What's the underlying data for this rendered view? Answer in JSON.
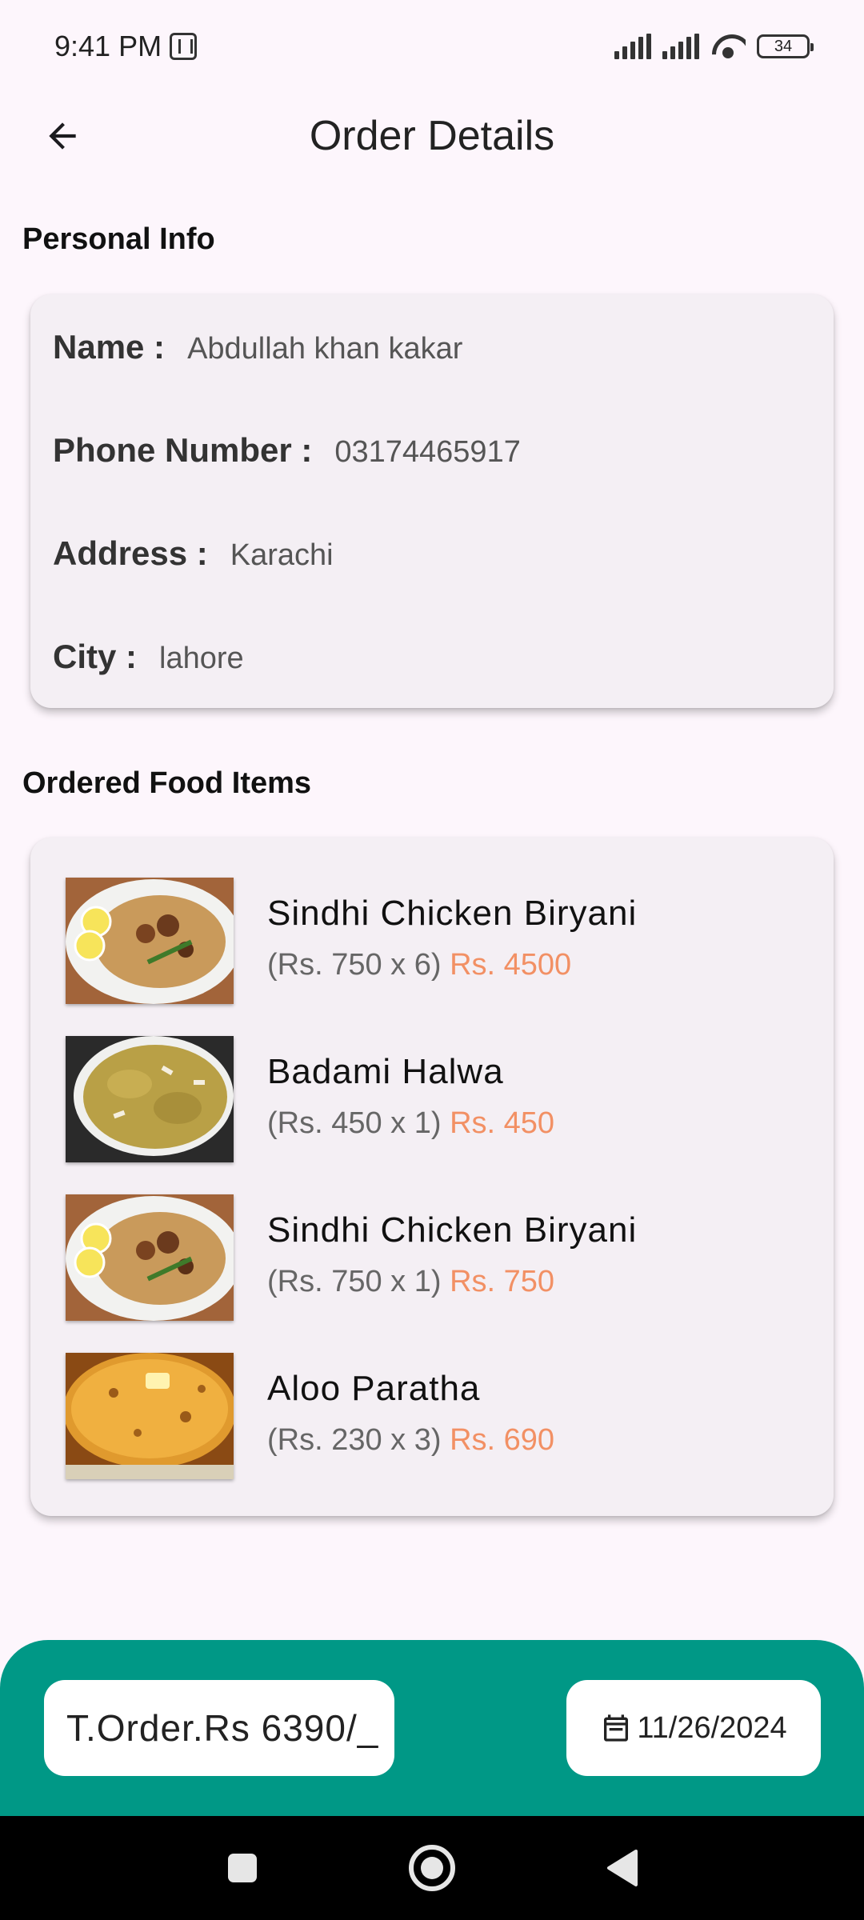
{
  "status_bar": {
    "time": "9:41 PM",
    "battery": "34"
  },
  "app_bar": {
    "title": "Order Details"
  },
  "personal_info": {
    "section_title": "Personal Info",
    "rows": [
      {
        "label": "Name :",
        "value": "Abdullah khan kakar"
      },
      {
        "label": "Phone Number :",
        "value": "03174465917"
      },
      {
        "label": "Address :",
        "value": "Karachi"
      },
      {
        "label": "City :",
        "value": "lahore"
      }
    ]
  },
  "ordered_items": {
    "section_title": "Ordered Food Items",
    "items": [
      {
        "name": "Sindhi Chicken Biryani",
        "unit": "(Rs. 750 x 6)",
        "total": "Rs. 4500",
        "image": "biryani"
      },
      {
        "name": "Badami Halwa",
        "unit": "(Rs. 450 x 1)",
        "total": "Rs. 450",
        "image": "halwa"
      },
      {
        "name": "Sindhi Chicken Biryani",
        "unit": "(Rs. 750 x 1)",
        "total": "Rs. 750",
        "image": "biryani"
      },
      {
        "name": "Aloo Paratha",
        "unit": "(Rs. 230 x 3)",
        "total": "Rs. 690",
        "image": "paratha"
      }
    ]
  },
  "bottom_bar": {
    "total_label": "T.Order.Rs 6390/_",
    "date": "11/26/2024"
  },
  "colors": {
    "accent": "#009886",
    "price_highlight": "#f29064",
    "card_bg": "#f4eff4",
    "page_bg": "#fdf6fc"
  }
}
